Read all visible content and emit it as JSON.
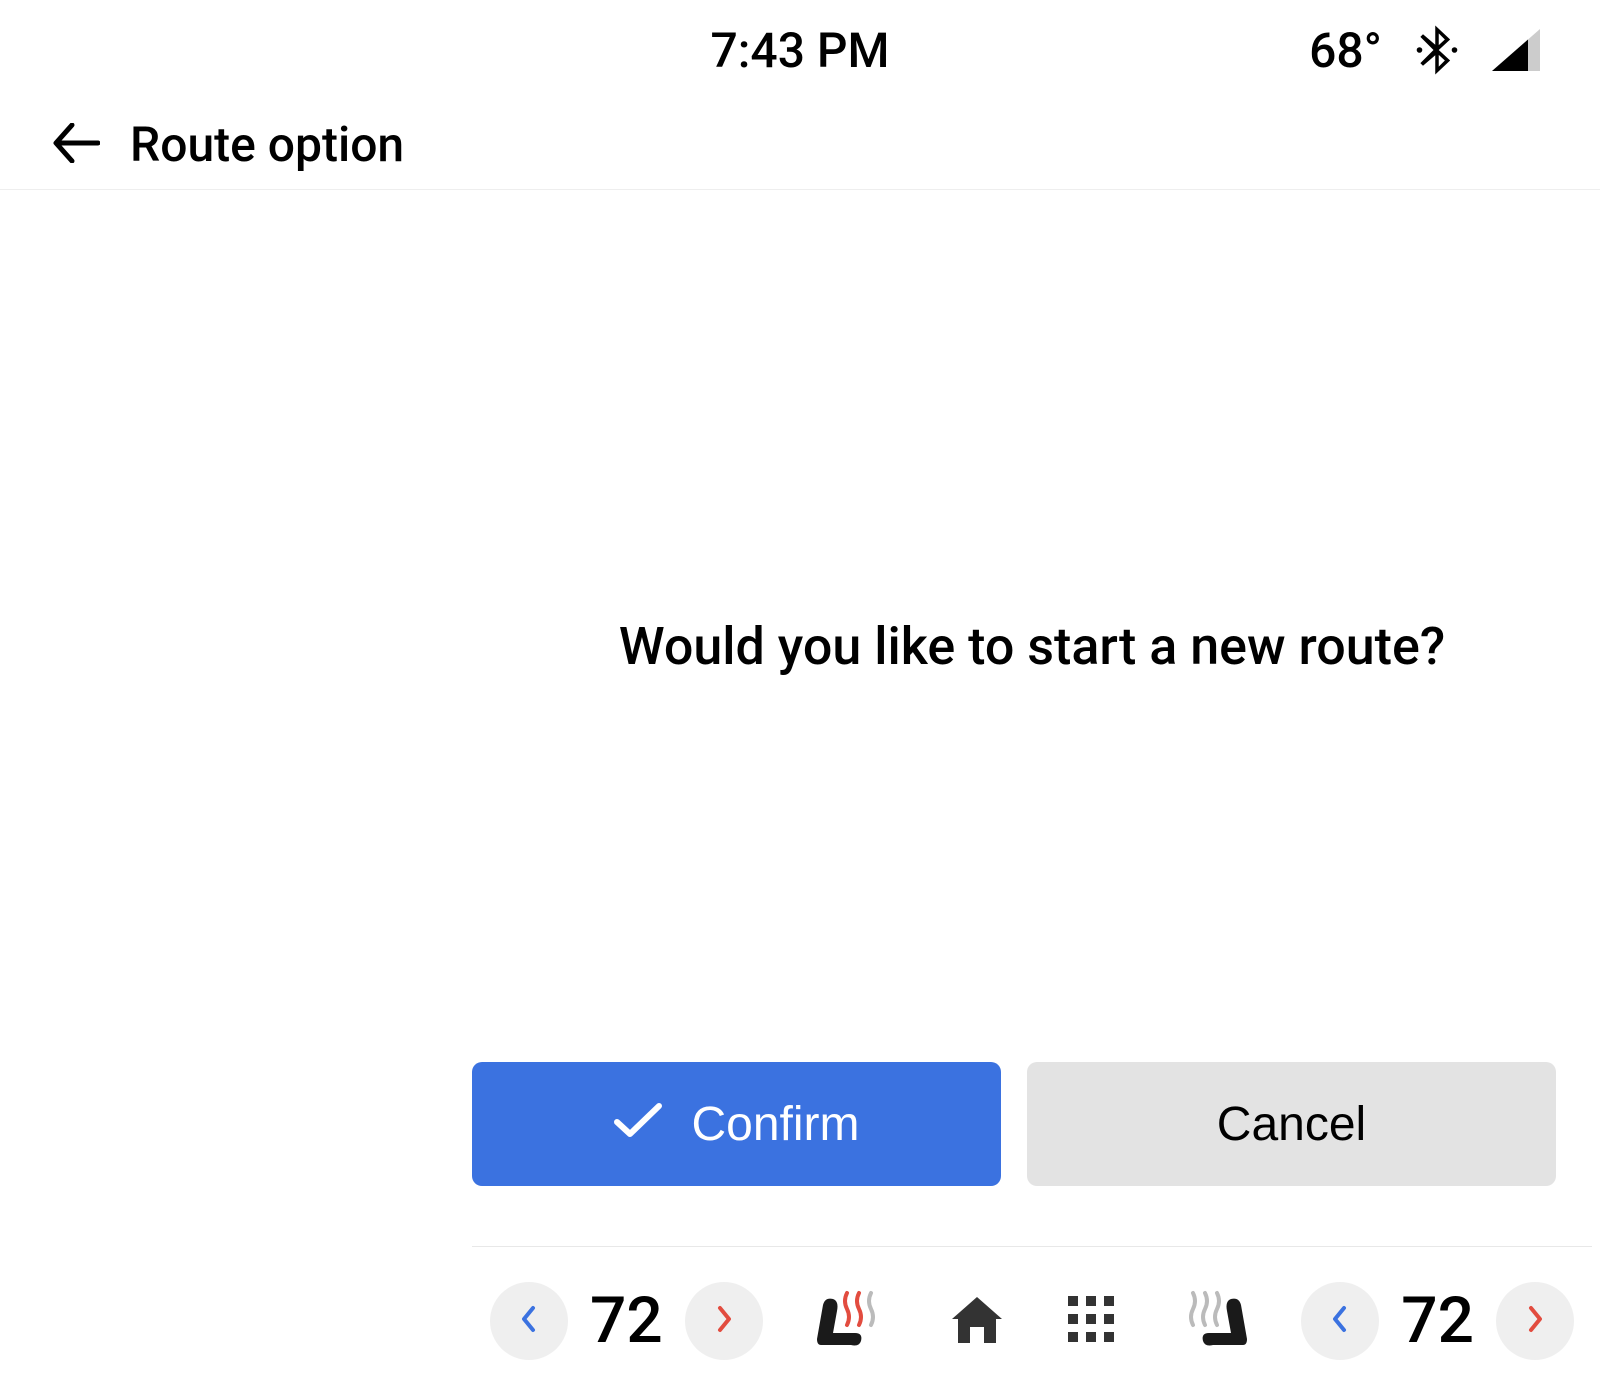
{
  "status": {
    "time": "7:43 PM",
    "temperature": "68°"
  },
  "header": {
    "title": "Route option"
  },
  "dialog": {
    "prompt": "Would you like to start a new route?",
    "confirm_label": "Confirm",
    "cancel_label": "Cancel"
  },
  "climate": {
    "left_temp": "72",
    "right_temp": "72"
  },
  "colors": {
    "primary": "#3b72e0",
    "chevron_blue": "#3b72e0",
    "chevron_red": "#e24c3f"
  }
}
